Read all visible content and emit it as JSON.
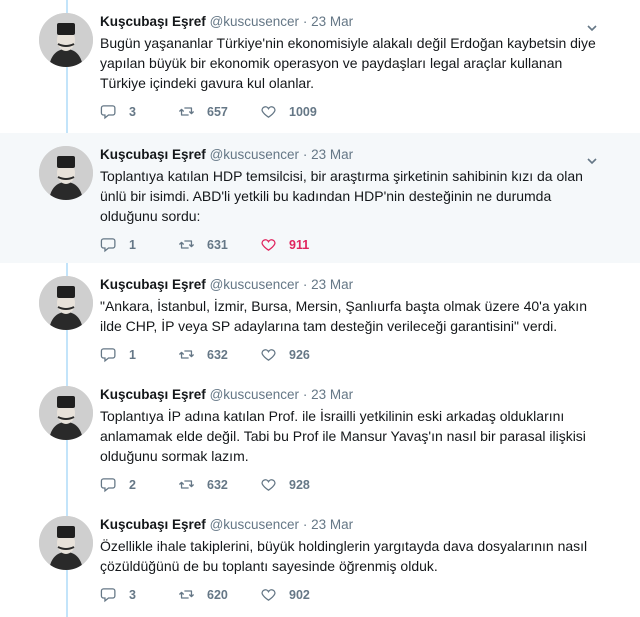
{
  "tweets": [
    {
      "name": "Kuşcubaşı Eşref",
      "handle": "@kuscusencer",
      "separator": "·",
      "time": "23 Mar",
      "text": "Bugün yaşananlar Türkiye'nin ekonomisiyle alakalı değil Erdoğan kaybetsin diye yapılan büyük bir ekonomik operasyon ve paydaşları legal araçlar kullanan Türkiye içindeki gavura kul olanlar.",
      "replies": "3",
      "retweets": "657",
      "likes": "1009",
      "liked": false
    },
    {
      "name": "Kuşcubaşı Eşref",
      "handle": "@kuscusencer",
      "separator": "·",
      "time": "23 Mar",
      "text": "Toplantıya katılan HDP temsilcisi, bir araştırma şirketinin sahibinin kızı da olan ünlü bir isimdi. ABD'li yetkili bu kadından HDP'nin desteğinin ne durumda olduğunu sordu:",
      "replies": "1",
      "retweets": "631",
      "likes": "911",
      "liked": true
    },
    {
      "name": "Kuşcubaşı Eşref",
      "handle": "@kuscusencer",
      "separator": "·",
      "time": "23 Mar",
      "text": "\"Ankara, İstanbul, İzmir, Bursa, Mersin, Şanlıurfa başta olmak üzere 40'a yakın ilde CHP, İP veya SP adaylarına tam desteğin verileceği garantisini\" verdi.",
      "replies": "1",
      "retweets": "632",
      "likes": "926",
      "liked": false
    },
    {
      "name": "Kuşcubaşı Eşref",
      "handle": "@kuscusencer",
      "separator": "·",
      "time": "23 Mar",
      "text": "Toplantıya İP adına katılan Prof. ile İsrailli yetkilinin eski arkadaş olduklarını anlamamak elde değil. Tabi bu Prof ile Mansur Yavaş'ın nasıl bir parasal ilişkisi olduğunu sormak lazım.",
      "replies": "2",
      "retweets": "632",
      "likes": "928",
      "liked": false
    },
    {
      "name": "Kuşcubaşı Eşref",
      "handle": "@kuscusencer",
      "separator": "·",
      "time": "23 Mar",
      "text": "Özellikle ihale takiplerini, büyük holdinglerin yargıtayda dava dosyalarının nasıl çözüldüğünü de bu toplantı sayesinde öğrenmiş olduk.",
      "replies": "3",
      "retweets": "620",
      "likes": "902",
      "liked": false
    }
  ],
  "icons": {
    "reply": "reply-icon",
    "retweet": "retweet-icon",
    "like": "heart-icon",
    "caret": "chevron-down-icon"
  },
  "colors": {
    "accent_like": "#e0245e",
    "thread_line": "#c3e4fa",
    "muted": "#657786",
    "highlight_bg": "#f5f8fa"
  }
}
